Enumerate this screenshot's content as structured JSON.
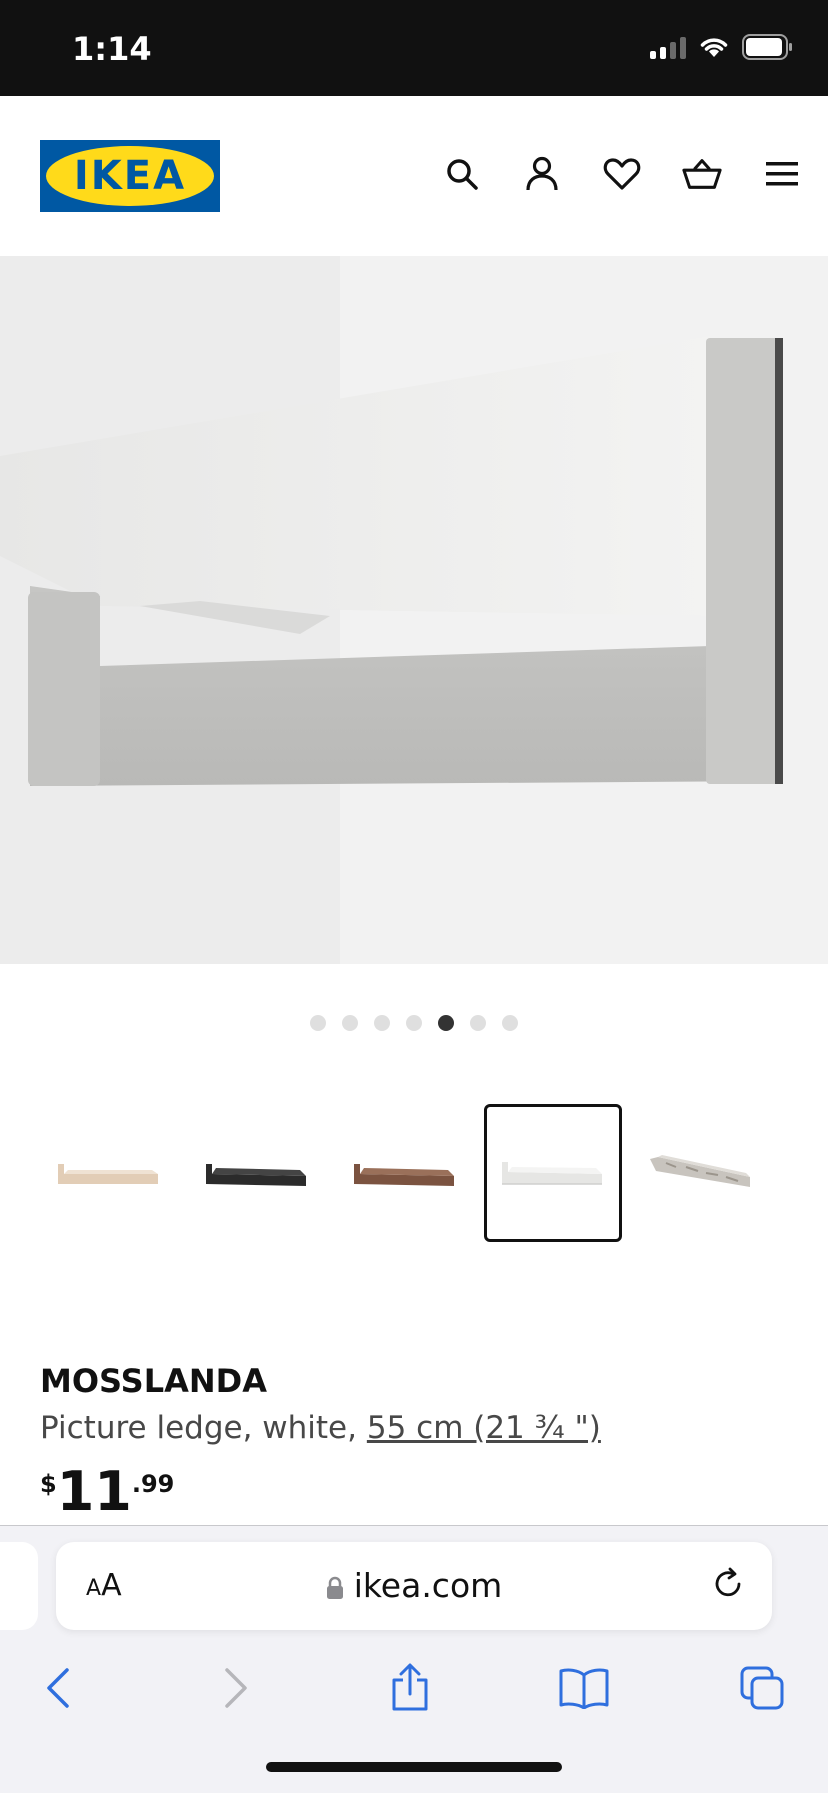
{
  "status_bar": {
    "time": "1:14"
  },
  "header": {
    "logo_text": "IKEA",
    "icons": [
      "search-icon",
      "account-icon",
      "heart-icon",
      "basket-icon",
      "menu-icon"
    ]
  },
  "gallery": {
    "dot_count": 7,
    "active_dot": 5,
    "thumbnails": [
      {
        "color": "white stained oak",
        "selected": false
      },
      {
        "color": "black",
        "selected": false
      },
      {
        "color": "brown",
        "selected": false
      },
      {
        "color": "white",
        "selected": true
      },
      {
        "color": "white patterned",
        "selected": false
      }
    ]
  },
  "product": {
    "name": "MOSSLANDA",
    "description": "Picture ledge, white,",
    "size_link": "55 cm (21 ¾ \")",
    "price_currency": "$",
    "price_integer": "11",
    "price_decimal": ".99"
  },
  "browser": {
    "text_size_label_small": "A",
    "text_size_label": "A",
    "url": "ikea.com"
  },
  "colors": {
    "ikea_blue": "#0058a3",
    "ikea_yellow": "#ffda1a",
    "safari_blue": "#2f6fde"
  }
}
